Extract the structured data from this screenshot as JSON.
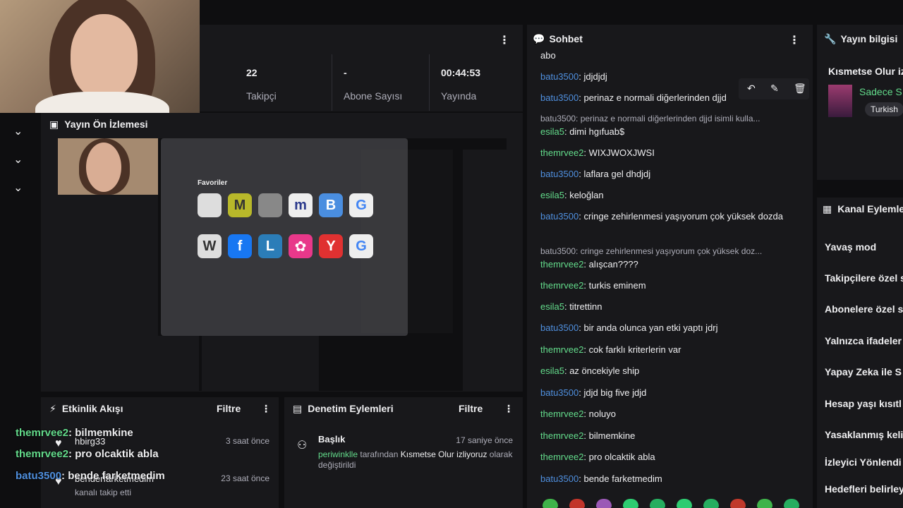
{
  "stats": {
    "followers_value": "22",
    "followers_label": "Takipçi",
    "subs_value": "-",
    "subs_label": "Abone Sayısı",
    "uptime_value": "00:44:53",
    "uptime_label": "Yayında"
  },
  "preview": {
    "title": "Yayın Ön İzlemesi",
    "favorites_title": "Favoriler"
  },
  "feed": {
    "title": "Etkinlik Akışı",
    "filter": "Filtre",
    "items": [
      {
        "name": "hbirg33",
        "time": "3 saat önce"
      },
      {
        "name": "benderfarketmedim",
        "sub": "kanalı takip etti",
        "time": "23 saat önce"
      }
    ]
  },
  "overlay_chat": [
    {
      "user": "themrvee2",
      "text": ": bilmemkine"
    },
    {
      "user": "themrvee2",
      "text": ": pro olcaktik abla"
    },
    {
      "user": "batu3500",
      "text": ": bende farketmedim"
    }
  ],
  "mod": {
    "title": "Denetim Eylemleri",
    "filter": "Filtre",
    "heading": "Başlık",
    "time": "17 saniye önce",
    "actor": "periwinklle",
    "desc_mid": " tarafından ",
    "new_title": "Kısmetse Olur izliyoruz",
    "desc_end": "olarak değiştirildi"
  },
  "chat": {
    "title": "Sohbet",
    "top_line": "abo",
    "messages": [
      {
        "user": "batu3500",
        "color": "blue",
        "text": ": jdjdjdj"
      },
      {
        "user": "batu3500",
        "color": "blue",
        "text": ": perinaz e normali diğerlerinden djjd"
      },
      {
        "reply": "batu3500: perinaz e normali diğerlerinden djjd isimli kulla..."
      },
      {
        "user": "esila5",
        "color": "green",
        "text": ": dimi hgıfuab$"
      },
      {
        "user": "themrvee2",
        "color": "green",
        "text": ": WIXJWOXJWSI"
      },
      {
        "user": "batu3500",
        "color": "blue",
        "text": ": laflara gel dhdjdj"
      },
      {
        "user": "esila5",
        "color": "green",
        "text": ": keloğlan"
      },
      {
        "user": "batu3500",
        "color": "blue",
        "text": ": cringe zehirlenmesi yaşıyorum çok yüksek dozda"
      },
      {
        "reply": "batu3500: cringe zehirlenmesi yaşıyorum çok yüksek doz..."
      },
      {
        "user": "themrvee2",
        "color": "green",
        "text": ": alışcan????"
      },
      {
        "user": "themrvee2",
        "color": "green",
        "text": ": turkis eminem"
      },
      {
        "user": "esila5",
        "color": "green",
        "text": ": titrettinn"
      },
      {
        "user": "batu3500",
        "color": "blue",
        "text": ": bir anda olunca yan etki yaptı jdrj"
      },
      {
        "user": "themrvee2",
        "color": "green",
        "text": ": cok farklı kriterlerin var"
      },
      {
        "user": "esila5",
        "color": "green",
        "text": ": az öncekiyle ship"
      },
      {
        "user": "batu3500",
        "color": "blue",
        "text": ": jdjd big five jdjd"
      },
      {
        "user": "themrvee2",
        "color": "green",
        "text": ": noluyo"
      },
      {
        "user": "themrvee2",
        "color": "green",
        "text": ": bilmemkine"
      },
      {
        "user": "themrvee2",
        "color": "green",
        "text": ": pro olcaktik abla"
      },
      {
        "user": "batu3500",
        "color": "blue",
        "text": ": bende farketmedim"
      }
    ]
  },
  "info": {
    "title": "Yayın bilgisi",
    "stream_title": "Kısmetse Olur iz",
    "category": "Sadece S",
    "tag": "Turkish"
  },
  "actions": {
    "title": "Kanal Eylemle",
    "items": [
      "Yavaş mod",
      "Takipçilere özel s",
      "Abonelere özel s",
      "Yalnızca ifadeler",
      "Yapay Zeka ile S",
      "Hesap yaşı kısıtl",
      "Yasaklanmış keli",
      "İzleyici Yönlendi",
      "Hedefleri belirley"
    ]
  },
  "colors": {
    "bg": "#0e0e10",
    "panel": "#18181b",
    "user_blue": "#4f8fde",
    "user_green": "#63db8b",
    "category_green": "#63db8b"
  }
}
